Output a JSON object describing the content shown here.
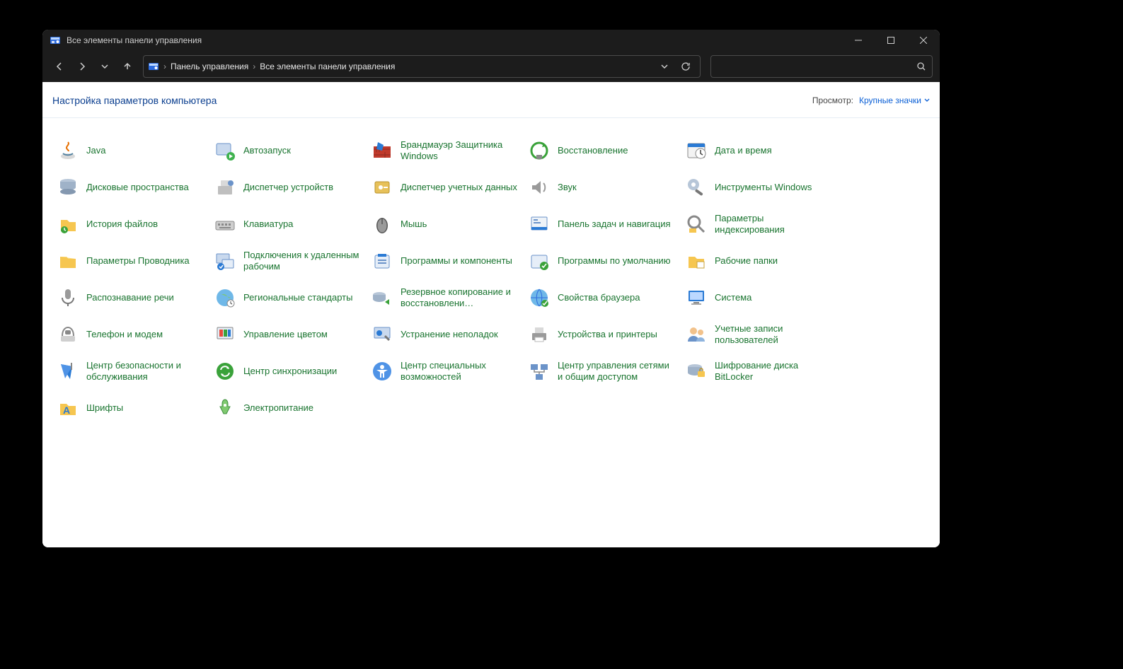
{
  "window": {
    "title": "Все элементы панели управления"
  },
  "breadcrumbs": {
    "root": "Панель управления",
    "current": "Все элементы панели управления"
  },
  "header": {
    "heading": "Настройка параметров компьютера",
    "view_label": "Просмотр:",
    "view_value": "Крупные значки"
  },
  "items": [
    {
      "label": "Java",
      "icon": "java"
    },
    {
      "label": "Автозапуск",
      "icon": "autoplay"
    },
    {
      "label": "Брандмауэр Защитника Windows",
      "icon": "firewall"
    },
    {
      "label": "Восстановление",
      "icon": "recovery"
    },
    {
      "label": "Дата и время",
      "icon": "datetime"
    },
    {
      "label": "Дисковые пространства",
      "icon": "storage-spaces"
    },
    {
      "label": "Диспетчер устройств",
      "icon": "device-manager"
    },
    {
      "label": "Диспетчер учетных данных",
      "icon": "credential-manager"
    },
    {
      "label": "Звук",
      "icon": "sound"
    },
    {
      "label": "Инструменты Windows",
      "icon": "windows-tools"
    },
    {
      "label": "История файлов",
      "icon": "file-history"
    },
    {
      "label": "Клавиатура",
      "icon": "keyboard"
    },
    {
      "label": "Мышь",
      "icon": "mouse"
    },
    {
      "label": "Панель задач и навигация",
      "icon": "taskbar"
    },
    {
      "label": "Параметры индексирования",
      "icon": "indexing"
    },
    {
      "label": "Параметры Проводника",
      "icon": "folder-options"
    },
    {
      "label": "Подключения к удаленным рабочим",
      "icon": "remote-desktop"
    },
    {
      "label": "Программы и компоненты",
      "icon": "programs"
    },
    {
      "label": "Программы по умолчанию",
      "icon": "default-programs"
    },
    {
      "label": "Рабочие папки",
      "icon": "work-folders"
    },
    {
      "label": "Распознавание речи",
      "icon": "speech"
    },
    {
      "label": "Региональные стандарты",
      "icon": "region"
    },
    {
      "label": "Резервное копирование и восстановлени…",
      "icon": "backup"
    },
    {
      "label": "Свойства браузера",
      "icon": "internet-options"
    },
    {
      "label": "Система",
      "icon": "system"
    },
    {
      "label": "Телефон и модем",
      "icon": "phone-modem"
    },
    {
      "label": "Управление цветом",
      "icon": "color-management"
    },
    {
      "label": "Устранение неполадок",
      "icon": "troubleshooting"
    },
    {
      "label": "Устройства и принтеры",
      "icon": "devices-printers"
    },
    {
      "label": "Учетные записи пользователей",
      "icon": "user-accounts"
    },
    {
      "label": "Центр безопасности и обслуживания",
      "icon": "security-center"
    },
    {
      "label": "Центр синхронизации",
      "icon": "sync-center"
    },
    {
      "label": "Центр специальных возможностей",
      "icon": "ease-of-access"
    },
    {
      "label": "Центр управления сетями и общим доступом",
      "icon": "network-sharing"
    },
    {
      "label": "Шифрование диска BitLocker",
      "icon": "bitlocker"
    },
    {
      "label": "Шрифты",
      "icon": "fonts"
    },
    {
      "label": "Электропитание",
      "icon": "power-options"
    }
  ]
}
